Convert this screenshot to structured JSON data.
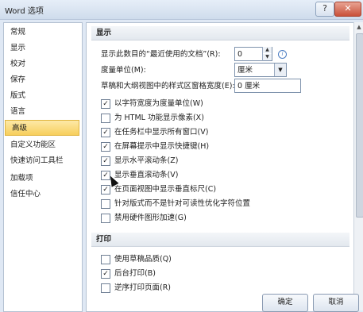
{
  "window": {
    "title": "Word 选项",
    "help_glyph": "?",
    "close_glyph": "✕"
  },
  "sidebar": {
    "items": [
      {
        "label": "常规"
      },
      {
        "label": "显示"
      },
      {
        "label": "校对"
      },
      {
        "label": "保存"
      },
      {
        "label": "版式"
      },
      {
        "label": "语言"
      },
      {
        "label": "高级",
        "selected": true
      },
      {
        "label": "自定义功能区"
      },
      {
        "label": "快速访问工具栏"
      },
      {
        "label": "加载项"
      },
      {
        "label": "信任中心"
      }
    ]
  },
  "display_section": {
    "header": "显示",
    "recent_docs": {
      "label": "显示此数目的“最近使用的文档”(R):",
      "value": "0"
    },
    "units": {
      "label": "度量单位(M):",
      "value": "厘米"
    },
    "style_width": {
      "label": "草稿和大纲视图中的样式区窗格宽度(E):",
      "value": "0 厘米"
    },
    "checkboxes": [
      {
        "label": "以字符宽度为度量单位(W)",
        "checked": true
      },
      {
        "label": "为 HTML 功能显示像素(X)",
        "checked": false
      },
      {
        "label": "在任务栏中显示所有窗口(V)",
        "checked": true
      },
      {
        "label": "在屏幕提示中显示快捷键(H)",
        "checked": true
      },
      {
        "label": "显示水平滚动条(Z)",
        "checked": true
      },
      {
        "label": "显示垂直滚动条(V)",
        "checked": true
      },
      {
        "label": "在页面视图中显示垂直标尺(C)",
        "checked": true
      },
      {
        "label": "针对版式而不是针对可读性优化字符位置",
        "checked": false
      },
      {
        "label": "禁用硬件图形加速(G)",
        "checked": false
      }
    ]
  },
  "print_section": {
    "header": "打印",
    "checkboxes": [
      {
        "label": "使用草稿品质(Q)",
        "checked": false
      },
      {
        "label": "后台打印(B)",
        "checked": true
      },
      {
        "label": "逆序打印页面(R)",
        "checked": false
      }
    ]
  },
  "footer": {
    "ok_label": "确定",
    "cancel_label": "取消"
  },
  "icons": {
    "checkmark": "✓",
    "dropdown": "▼",
    "spin_up": "▲",
    "spin_down": "▼",
    "info": "i"
  },
  "colors": {
    "selected_nav": "#f7cf5d",
    "window_bg": "#dfe8f4"
  }
}
